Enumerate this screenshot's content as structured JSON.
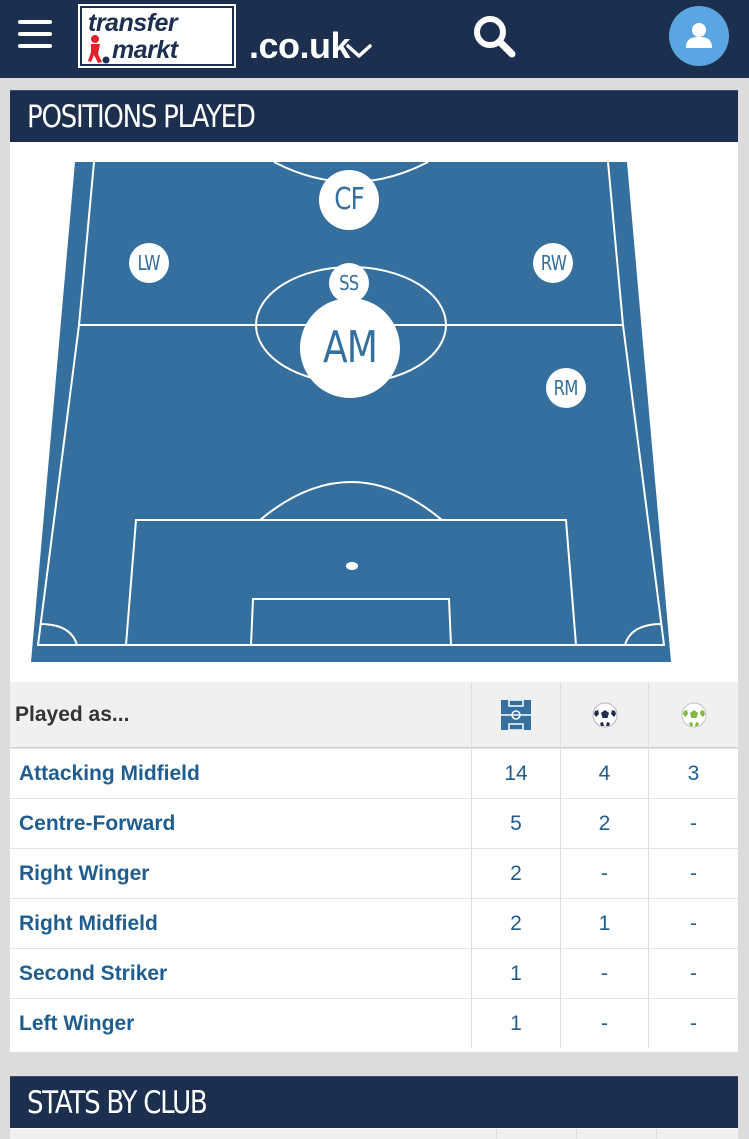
{
  "header": {
    "logo_line1": "transfer",
    "logo_line2": "markt",
    "domain": ".co.uk",
    "icons": [
      "menu-icon",
      "search-icon",
      "chevron-down-icon",
      "user-icon"
    ]
  },
  "positions_card": {
    "title": "POSITIONS PLAYED",
    "pitch_markers": {
      "cf": "CF",
      "lw": "LW",
      "rw": "RW",
      "ss": "SS",
      "am": "AM",
      "rm": "RM"
    },
    "table": {
      "header_label": "Played as...",
      "header_icons": [
        "pitch-icon",
        "goal-ball-icon",
        "assist-ball-icon"
      ],
      "rows": [
        {
          "position": "Attacking Midfield",
          "apps": "14",
          "goals": "4",
          "assists": "3"
        },
        {
          "position": "Centre-Forward",
          "apps": "5",
          "goals": "2",
          "assists": "-"
        },
        {
          "position": "Right Winger",
          "apps": "2",
          "goals": "-",
          "assists": "-"
        },
        {
          "position": "Right Midfield",
          "apps": "2",
          "goals": "1",
          "assists": "-"
        },
        {
          "position": "Second Striker",
          "apps": "1",
          "goals": "-",
          "assists": "-"
        },
        {
          "position": "Left Winger",
          "apps": "1",
          "goals": "-",
          "assists": "-"
        }
      ]
    }
  },
  "stats_card": {
    "title": "STATS BY CLUB"
  },
  "colors": {
    "header_bg": "#1d2f4e",
    "pitch": "#346f9d",
    "link": "#1f5d8f",
    "user_button": "#5aa6e0"
  }
}
